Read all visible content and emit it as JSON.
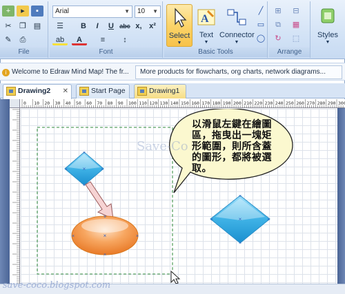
{
  "ribbon": {
    "clipboard": {
      "label": "File"
    },
    "font": {
      "label": "Font",
      "family": "Arial",
      "size": "10",
      "buttons": [
        "B",
        "I",
        "U",
        "abc",
        "x,",
        "x²"
      ]
    },
    "basic_tools": {
      "label": "Basic Tools",
      "select": "Select",
      "text": "Text",
      "connector": "Connector"
    },
    "arrange": {
      "label": "Arrange"
    },
    "styles": {
      "label": "Styles"
    }
  },
  "banner": {
    "welcome": "Welcome to Edraw Mind Map! The fr...",
    "more": "More products for flowcharts, org charts, network diagrams..."
  },
  "tabs": [
    {
      "label": "Drawing2"
    },
    {
      "label": "Start Page"
    },
    {
      "label": "Drawing1"
    }
  ],
  "ruler": {
    "ticks": [
      "0",
      "10",
      "20",
      "30",
      "40",
      "50",
      "60",
      "70",
      "80",
      "90",
      "100",
      "110",
      "120",
      "130",
      "140",
      "150",
      "160",
      "170",
      "180",
      "190",
      "200",
      "210",
      "220",
      "230",
      "240",
      "250",
      "260",
      "270",
      "280",
      "290",
      "300"
    ]
  },
  "canvas": {
    "callout_lines": [
      "以滑鼠左鍵在繪圖",
      "區，拖曳出一塊矩",
      "形範圍，則所含蓋",
      "的圖形，都將被選",
      "取。"
    ],
    "watermark": "Save-Co"
  },
  "footer": {
    "watermark": "save-coco.blogspot.com"
  },
  "colors": {
    "diamond": "#3fb2e6",
    "ellipse": "#f0883a",
    "callout_fill": "#fbf8cf",
    "selection_dash": "#2e8a3a"
  }
}
